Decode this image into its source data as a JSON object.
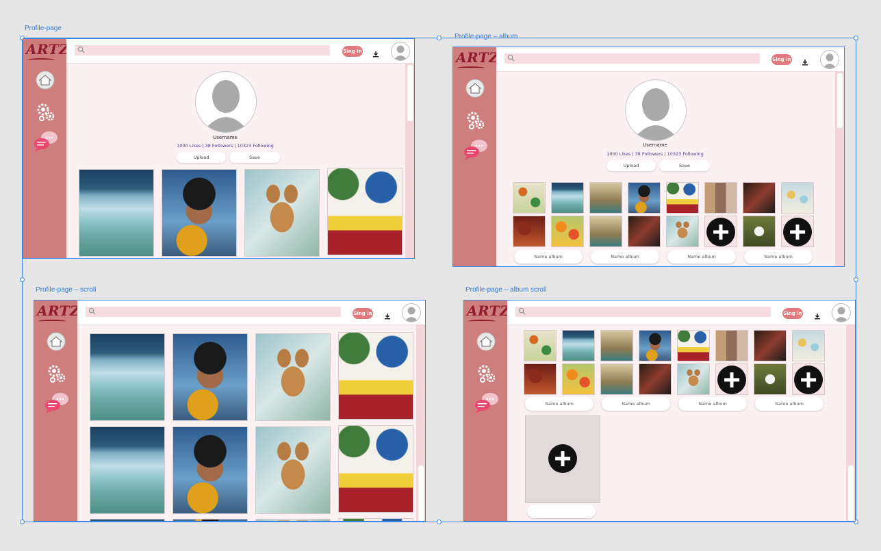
{
  "artboards": {
    "profile": "Profile-page",
    "album": "Profile-page – album",
    "scroll": "Profile-page – scroll",
    "album_scroll": "Profile-page – album  scroll"
  },
  "app": {
    "logo": "ARTZY",
    "signin_label": "Sing in",
    "search_placeholder": ""
  },
  "profile": {
    "username": "Username",
    "stats": "1000 Likes |  38 Followers | 10323 Following",
    "upload_label": "Upload",
    "save_label": "Save"
  },
  "albums": {
    "name_label": "Name album"
  },
  "colors": {
    "sidebar": "#cf7e7e",
    "accent": "#e07a7e",
    "page_bg": "#fbf1f3",
    "search_bg": "#f7dde1",
    "selection": "#3a86e6"
  },
  "icons": [
    "search-icon",
    "download-icon",
    "home-icon",
    "settings-icon",
    "chat-icon",
    "user-icon",
    "add-icon"
  ]
}
